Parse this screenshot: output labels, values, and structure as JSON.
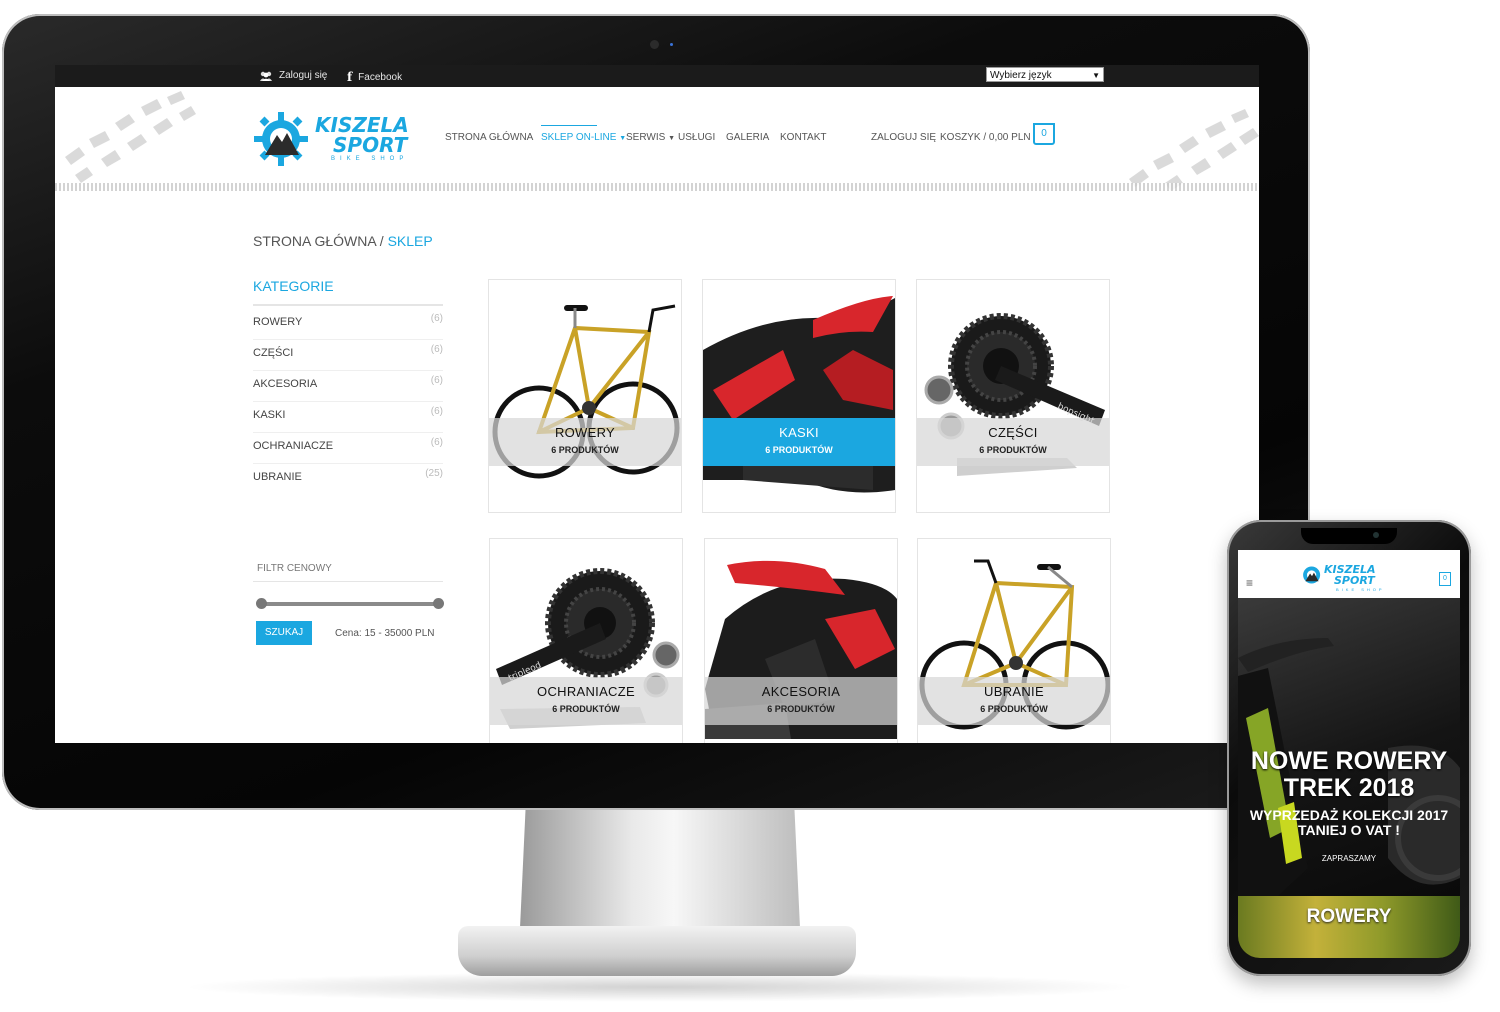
{
  "colors": {
    "accent": "#1ba7e0",
    "topbar": "#1b1b1b"
  },
  "topbar": {
    "login_label": "Zaloguj się",
    "login_icon": "users-icon",
    "facebook_label": "Facebook",
    "facebook_icon": "facebook-icon",
    "language_select": "Wybierz język"
  },
  "brand": {
    "line1": "KISZELA",
    "line2": "SPORT",
    "tagline": "BIKE SHOP"
  },
  "nav": {
    "items": [
      {
        "label": "STRONA GŁÓWNA"
      },
      {
        "label": "SKLEP ON-LINE"
      },
      {
        "label": "SERWIS"
      },
      {
        "label": "USŁUGI"
      },
      {
        "label": "GALERIA"
      },
      {
        "label": "KONTAKT"
      }
    ],
    "login": "ZALOGUJ SIĘ",
    "cart": "KOSZYK / 0,00 PLN",
    "cart_count": "0"
  },
  "breadcrumb": {
    "home": "STRONA GŁÓWNA",
    "separator": " / ",
    "current": "SKLEP"
  },
  "sidebar": {
    "title": "KATEGORIE",
    "categories": [
      {
        "name": "ROWERY",
        "count": "(6)"
      },
      {
        "name": "CZĘŚCI",
        "count": "(6)"
      },
      {
        "name": "AKCESORIA",
        "count": "(6)"
      },
      {
        "name": "KASKI",
        "count": "(6)"
      },
      {
        "name": "OCHRANIACZE",
        "count": "(6)"
      },
      {
        "name": "UBRANIE",
        "count": "(25)"
      }
    ],
    "filter_title": "FILTR CENOWY",
    "search_button": "SZUKAJ",
    "price_range": "Cena: 15 - 35000 PLN"
  },
  "products": [
    {
      "title": "ROWERY",
      "count": "6 PRODUKTÓW",
      "image": "bicycle"
    },
    {
      "title": "KASKI",
      "count": "6 PRODUKTÓW",
      "image": "helmet"
    },
    {
      "title": "CZĘŚCI",
      "count": "6 PRODUKTÓW",
      "image": "crankset"
    },
    {
      "title": "OCHRANIACZE",
      "count": "6 PRODUKTÓW",
      "image": "crankset"
    },
    {
      "title": "AKCESORIA",
      "count": "6 PRODUKTÓW",
      "image": "helmet"
    },
    {
      "title": "UBRANIE",
      "count": "6 PRODUKTÓW",
      "image": "bicycle"
    }
  ],
  "mobile": {
    "hero_title_1": "NOWE ROWERY",
    "hero_title_2": "TREK 2018",
    "hero_sub_1": "WYPRZEDAŻ KOLEKCJI 2017",
    "hero_sub_2": "TANIEJ O VAT !",
    "hero_cta": "ZAPRASZAMY",
    "cart_count": "0",
    "band_label": "ROWERY"
  }
}
